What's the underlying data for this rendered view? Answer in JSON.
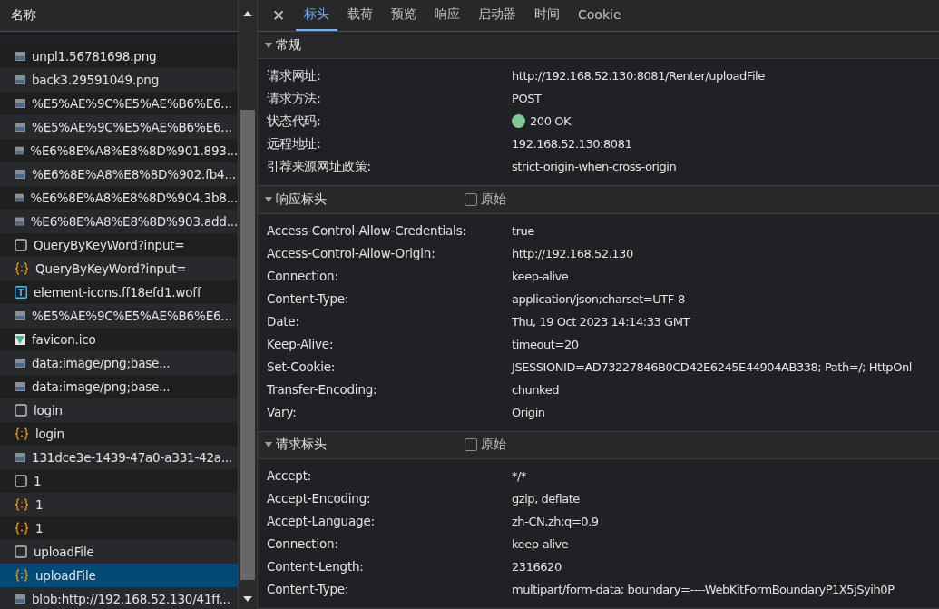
{
  "request_list": {
    "column_header": "名称",
    "rows": [
      {
        "name": "unpl1.56781698.png",
        "kind": "image",
        "selected": false
      },
      {
        "name": "back3.29591049.png",
        "kind": "image",
        "selected": false
      },
      {
        "name": "%E5%AE%9C%E5%AE%B6%E6...",
        "kind": "image",
        "selected": false
      },
      {
        "name": "%E5%AE%9C%E5%AE%B6%E6...",
        "kind": "image",
        "selected": false
      },
      {
        "name": "%E6%8E%A8%E8%8D%901.893...",
        "kind": "image",
        "selected": false
      },
      {
        "name": "%E6%8E%A8%E8%8D%902.fb4...",
        "kind": "image",
        "selected": false
      },
      {
        "name": "%E6%8E%A8%E8%8D%904.3b8...",
        "kind": "image",
        "selected": false
      },
      {
        "name": "%E6%8E%A8%E8%8D%903.add...",
        "kind": "image",
        "selected": false
      },
      {
        "name": "QueryByKeyWord?input=",
        "kind": "document",
        "selected": false
      },
      {
        "name": "QueryByKeyWord?input=",
        "kind": "fetch",
        "selected": false
      },
      {
        "name": "element-icons.ff18efd1.woff",
        "kind": "font",
        "selected": false
      },
      {
        "name": "%E5%AE%9C%E5%AE%B6%E6...",
        "kind": "image",
        "selected": false
      },
      {
        "name": "favicon.ico",
        "kind": "favicon",
        "selected": false
      },
      {
        "name": "data:image/png;base...",
        "kind": "image",
        "selected": false
      },
      {
        "name": "data:image/png;base...",
        "kind": "image",
        "selected": false
      },
      {
        "name": "login",
        "kind": "document",
        "selected": false
      },
      {
        "name": "login",
        "kind": "fetch",
        "selected": false
      },
      {
        "name": "131dce3e-1439-47a0-a331-42a...",
        "kind": "image",
        "selected": false
      },
      {
        "name": "1",
        "kind": "document",
        "selected": false
      },
      {
        "name": "1",
        "kind": "fetch",
        "selected": false
      },
      {
        "name": "1",
        "kind": "fetch",
        "selected": false
      },
      {
        "name": "uploadFile",
        "kind": "document",
        "selected": false
      },
      {
        "name": "uploadFile",
        "kind": "fetch",
        "selected": true
      },
      {
        "name": "blob:http://192.168.52.130/41ff...",
        "kind": "image",
        "selected": false
      }
    ]
  },
  "close_button": "✕",
  "tabs": [
    {
      "label": "标头",
      "selected": true
    },
    {
      "label": "载荷",
      "selected": false
    },
    {
      "label": "预览",
      "selected": false
    },
    {
      "label": "响应",
      "selected": false
    },
    {
      "label": "启动器",
      "selected": false
    },
    {
      "label": "时间",
      "selected": false
    },
    {
      "label": "Cookie",
      "selected": false
    }
  ],
  "sections": [
    {
      "title": "常规",
      "expanded": true,
      "rows": [
        {
          "label": "请求网址:",
          "value": "http://192.168.52.130:8081/Renter/uploadFile"
        },
        {
          "label": "请求方法:",
          "value": "POST"
        },
        {
          "label": "状态代码:",
          "value": "200 OK",
          "color": "#81c995"
        },
        {
          "label": "远程地址:",
          "value": "192.168.52.130:8081"
        },
        {
          "label": "引荐来源网址政策:",
          "value": "strict-origin-when-cross-origin"
        }
      ]
    },
    {
      "title": "响应标头",
      "expanded": true,
      "raw": {
        "label": "原始",
        "checked": false
      },
      "rows": [
        {
          "label": "Access-Control-Allow-Credentials:",
          "value": "true"
        },
        {
          "label": "Access-Control-Allow-Origin:",
          "value": "http://192.168.52.130"
        },
        {
          "label": "Connection:",
          "value": "keep-alive"
        },
        {
          "label": "Content-Type:",
          "value": "application/json;charset=UTF-8"
        },
        {
          "label": "Date:",
          "value": "Thu, 19 Oct 2023 14:14:33 GMT"
        },
        {
          "label": "Keep-Alive:",
          "value": "timeout=20"
        },
        {
          "label": "Set-Cookie:",
          "value": "JSESSIONID=AD73227846B0CD42E6245E44904AB338; Path=/; HttpOnl"
        },
        {
          "label": "Transfer-Encoding:",
          "value": "chunked"
        },
        {
          "label": "Vary:",
          "value": "Origin"
        }
      ]
    },
    {
      "title": "请求标头",
      "expanded": true,
      "raw": {
        "label": "原始",
        "checked": false
      },
      "rows": [
        {
          "label": "Accept:",
          "value": "*/*"
        },
        {
          "label": "Accept-Encoding:",
          "value": "gzip, deflate"
        },
        {
          "label": "Accept-Language:",
          "value": "zh-CN,zh;q=0.9"
        },
        {
          "label": "Connection:",
          "value": "keep-alive"
        },
        {
          "label": "Content-Length:",
          "value": "2316620"
        },
        {
          "label": "Content-Type:",
          "value": "multipart/form-data; boundary=----WebKitFormBoundaryP1X5jSyih0P"
        }
      ]
    }
  ]
}
